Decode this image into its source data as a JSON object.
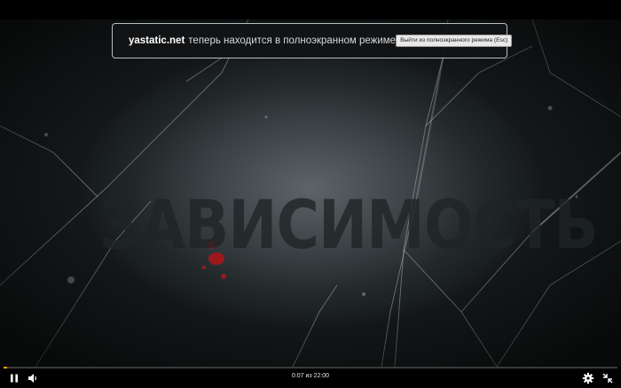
{
  "notice": {
    "domain": "yastatic.net",
    "message": "теперь находится в полноэкранном режиме",
    "exit_button": "Выйти из полноэкранного режима (Esc)",
    "icon": "lock-icon"
  },
  "video": {
    "title_overlay": "ЗАВИСИМОСТЬ"
  },
  "player": {
    "time_display": "0:07 из 22:00",
    "progress_fraction": 0.0053,
    "accent_color": "#f0a000",
    "icons": {
      "play_pause": "pause-icon",
      "volume": "volume-icon",
      "settings": "gear-icon",
      "fullscreen": "exit-fullscreen-icon"
    }
  }
}
